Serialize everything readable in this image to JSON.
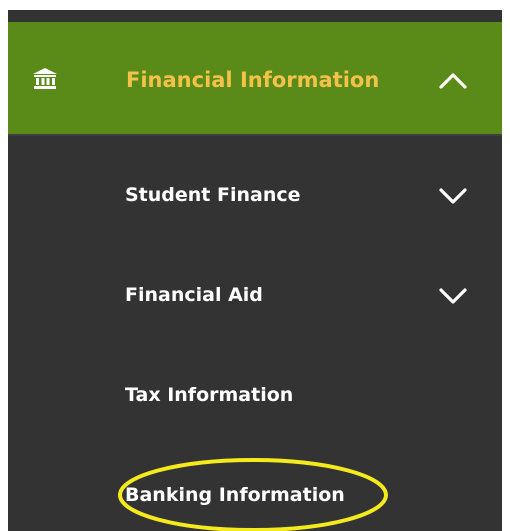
{
  "nav": {
    "header": {
      "label": "Financial Information",
      "icon": "bank-icon",
      "expanded": true
    },
    "items": [
      {
        "label": "Student Finance",
        "has_submenu": true,
        "icon": "chevron-down-icon"
      },
      {
        "label": "Financial Aid",
        "has_submenu": true,
        "icon": "chevron-down-icon"
      },
      {
        "label": "Tax Information",
        "has_submenu": false
      },
      {
        "label": "Banking Information",
        "has_submenu": false
      }
    ]
  },
  "colors": {
    "panel_background": "#333333",
    "header_background": "#5a8a18",
    "header_text": "#f2c24b",
    "item_text": "#ffffff",
    "highlight_annotation": "#f5ea1c"
  }
}
